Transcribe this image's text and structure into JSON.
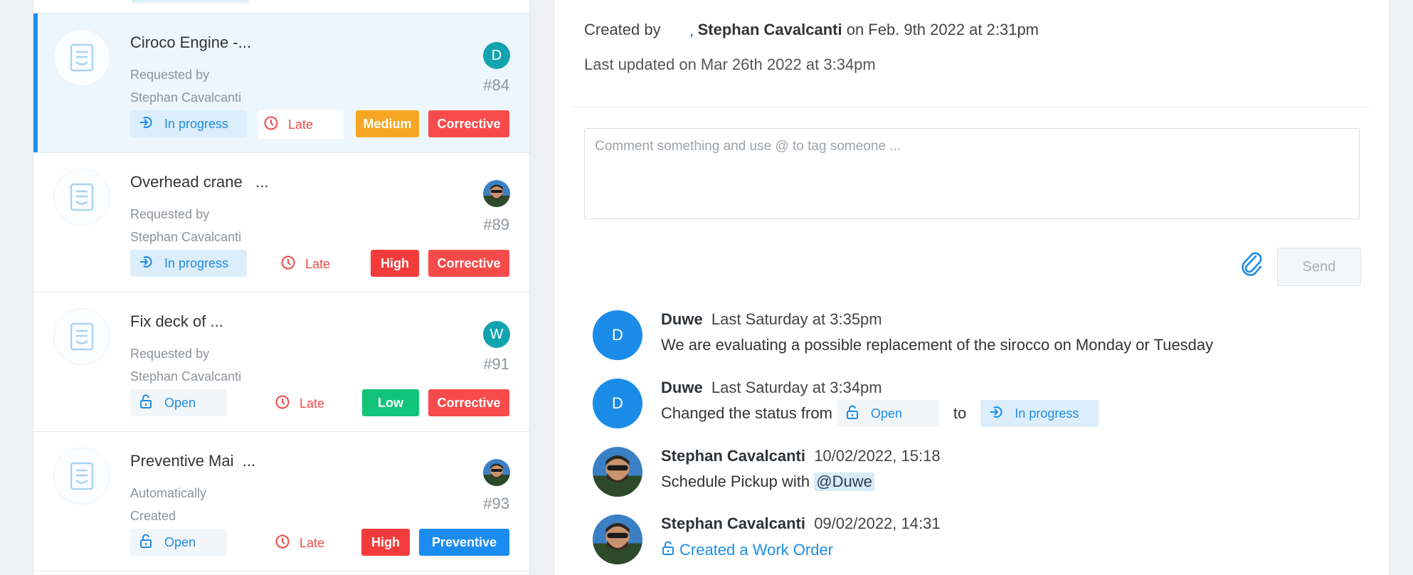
{
  "list": {
    "cards": [
      {
        "title": "Ciroco Engine -...",
        "requested_line1": "Requested by",
        "requested_line2": "Stephan Cavalcanti",
        "status": "In progress",
        "late": "Late",
        "priority": "Medium",
        "category": "Corrective",
        "assignee_initial": "D",
        "number": "#84",
        "selected": true
      },
      {
        "title": "Overhead crane   ...",
        "requested_line1": "Requested by",
        "requested_line2": "Stephan Cavalcanti",
        "status": "In progress",
        "late": "Late",
        "priority": "High",
        "category": "Corrective",
        "number": "#89"
      },
      {
        "title": "Fix deck of ...",
        "requested_line1": "Requested by",
        "requested_line2": "Stephan Cavalcanti",
        "status": "Open",
        "late": "Late",
        "priority": "Low",
        "category": "Corrective",
        "assignee_initial": "W",
        "number": "#91"
      },
      {
        "title": "Preventive Mai  ...",
        "requested_line1": "Automatically",
        "requested_line2": "Created",
        "status": "Open",
        "late": "Late",
        "priority": "High",
        "category": "Preventive",
        "number": "#93"
      }
    ]
  },
  "detail": {
    "created_prefix": "Created by",
    "created_by": "Stephan Cavalcanti",
    "created_suffix": "on Feb. 9th 2022 at 2:31pm",
    "last_updated": "Last updated on Mar 26th 2022 at 3:34pm",
    "comment_placeholder": "Comment something and use @ to tag someone ...",
    "send_label": "Send",
    "activity": [
      {
        "author": "Duwe",
        "initial": "D",
        "time": "Last Saturday at 3:35pm",
        "text": "We are evaluating a possible replacement of the sirocco on Monday or Tuesday"
      },
      {
        "author": "Duwe",
        "initial": "D",
        "time": "Last Saturday at 3:34pm",
        "prefix": "Changed the status from",
        "from_status": "Open",
        "connector": "to",
        "to_status": "In progress"
      },
      {
        "author": "Stephan Cavalcanti",
        "time": "10/02/2022, 15:18",
        "text": "Schedule Pickup with",
        "mention": "@Duwe"
      },
      {
        "author": "Stephan Cavalcanti",
        "time": "09/02/2022, 14:31",
        "link": "Created a Work Order"
      }
    ]
  },
  "colors": {
    "accent": "#1f8ce6",
    "late": "#f04848",
    "medium": "#f6a623",
    "high": "#f43b3b",
    "low": "#12c47a",
    "corrective": "#f74b4b",
    "preventive": "#1a8cf0",
    "avatar_d": "#12a3b0",
    "avatar_w": "#12a3b0"
  },
  "icons": {
    "document": "document-icon",
    "status_in_progress": "sign-in-icon",
    "status_open": "unlock-icon",
    "late": "clock-icon",
    "attach": "paperclip-icon"
  }
}
